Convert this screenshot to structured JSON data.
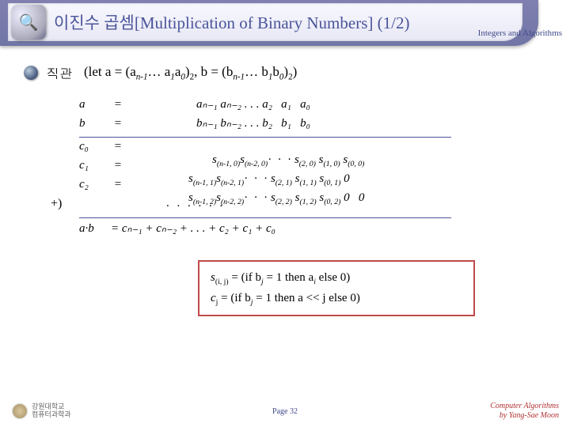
{
  "header": {
    "title": "이진수 곱셈[Multiplication of Binary Numbers] (1/2)",
    "course": "Integers and Algorithms"
  },
  "bullet": {
    "label": "직관",
    "let": "(let a = (a",
    "sub1": "n-1",
    "mid1": "… a",
    "sub2": "1",
    "mid2": "a",
    "sub3": "0",
    "mid3": ")",
    "sub4": "2",
    "mid4": ", b = (b",
    "sub5": "n-1",
    "mid5": "… b",
    "sub6": "1",
    "mid6": "b",
    "sub7": "0",
    "mid7": ")",
    "sub8": "2",
    "end": ")"
  },
  "calc": {
    "r_a_lbl": "a",
    "r_a_rhs": "aₙ₋₁ aₙ₋₂ . . . a₂   a₁   a₀",
    "r_b_lbl": "b",
    "r_b_rhs": "bₙ₋₁ bₙ₋₂ . . . b₂   b₁   b₀",
    "eq": "=",
    "c0_lbl": "c₀",
    "c1_lbl": "c₁",
    "c2_lbl": "c₂",
    "plus": "+)",
    "dots6": ". . . . . .",
    "ab_lbl": "a·b",
    "ab_rhs": "= cₙ₋₁ + cₙ₋₂ + . . . + c₂ + c₁ + c₀"
  },
  "sline": {
    "c0": {
      "a": "s",
      "a_s": "(n-1, 0)",
      "b": "s",
      "b_s": "(n-2, 0)",
      "d": "·  ·  · ",
      "e": "s",
      "e_s": "(2, 0)",
      "f": " s",
      "f_s": "(1, 0)",
      "g": " s",
      "g_s": "(0, 0)"
    },
    "c1": {
      "pre": "s",
      "pre_s": "(n-1, 1)",
      "a": "s",
      "a_s": "(n-2, 1)",
      "d": "·  ·  · ",
      "e": "s",
      "e_s": "(2, 1)",
      "f": " s",
      "f_s": "(1, 1)",
      "g": " s",
      "g_s": "(0, 1)",
      "z": " 0"
    },
    "c2": {
      "pre": "s",
      "pre_s": "(n-1, 2)",
      "a": "s",
      "a_s": "(n-2, 2)",
      "d": "·  ·  · ",
      "e": "s",
      "e_s": "(2, 2)",
      "f": " s",
      "f_s": "(1, 2)",
      "g": " s",
      "g_s": "(0, 2)",
      "z": " 0   0"
    }
  },
  "box": {
    "line1a": "s",
    "line1a_s": "(i, j)",
    "line1b": " = (if b",
    "line1b_s": "j",
    "line1c": " = 1 then a",
    "line1c_s": "i",
    "line1d": " else 0)",
    "line2a": "c",
    "line2a_s": "j",
    "line2b": " = (if b",
    "line2b_s": "j",
    "line2c": " = 1 then a << j else 0)"
  },
  "footer": {
    "page": "Page 32",
    "credit1": "Computer Algorithms",
    "credit2": "by Yang-Sae Moon"
  }
}
